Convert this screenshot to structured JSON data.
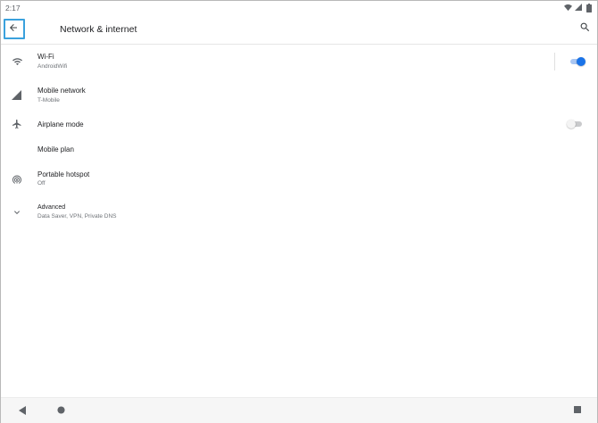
{
  "status_bar": {
    "time": "2:17",
    "icons": [
      "wifi-signal-icon",
      "cell-signal-icon",
      "battery-icon"
    ]
  },
  "app_bar": {
    "back_icon": "arrow-back-icon",
    "title": "Network & internet",
    "search_icon": "search-icon"
  },
  "items": [
    {
      "icon": "wifi-icon",
      "title": "Wi-Fi",
      "summary": "AndroidWifi",
      "toggle": true
    },
    {
      "icon": "cell-signal-icon",
      "title": "Mobile network",
      "summary": "T-Mobile"
    },
    {
      "icon": "airplane-icon",
      "title": "Airplane mode",
      "toggle": false
    },
    {
      "title": "Mobile plan"
    },
    {
      "icon": "hotspot-icon",
      "title": "Portable hotspot",
      "summary": "Off"
    },
    {
      "icon": "chevron-down-icon",
      "title": "Advanced",
      "summary": "Data Saver, VPN, Private DNS"
    }
  ],
  "nav_bar": [
    "nav-back-icon",
    "nav-home-icon",
    "nav-recents-icon"
  ],
  "colors": {
    "accent": "#1a73e8",
    "accent_track": "#a9c6f2",
    "highlight_border": "#3aa1dd",
    "text_primary": "#202124",
    "text_secondary": "#6f7378"
  }
}
